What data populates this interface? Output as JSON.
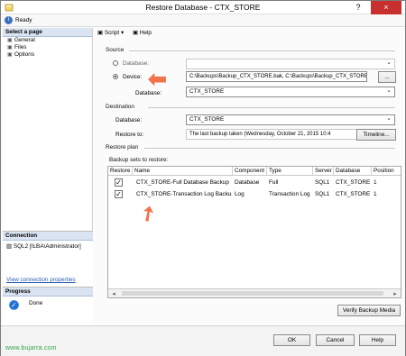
{
  "window": {
    "title": "Restore Database - CTX_STORE",
    "help_icon": "?",
    "close_icon": "×",
    "status": "Ready"
  },
  "sidebar": {
    "select_page": "Select a page",
    "pages": [
      {
        "label": "General",
        "icon": "page-icon"
      },
      {
        "label": "Files",
        "icon": "page-icon"
      },
      {
        "label": "Options",
        "icon": "page-icon"
      }
    ],
    "connection_title": "Connection",
    "connection_text": "SQL2 [ILBA\\Administrator]",
    "view_connection_properties": "View connection properties",
    "progress_title": "Progress",
    "progress_status": "Done"
  },
  "toolbar": {
    "script_label": "Script",
    "help_label": "Help",
    "script_icon": "script-icon",
    "help_icon": "help-icon"
  },
  "source": {
    "section_title": "Source",
    "database_option": "Database:",
    "device_option": "Device:",
    "device_value": "C:\\Backups\\Backup_CTX_STORE.bak, C:\\Backups\\Backup_CTX_STORE",
    "browse_label": "...",
    "database_label": "Database:",
    "database_value": "CTX_STORE"
  },
  "destination": {
    "section_title": "Destination",
    "database_label": "Database:",
    "database_value": "CTX_STORE",
    "restore_to_label": "Restore to:",
    "restore_to_value": "The last backup taken (Wednesday, October 21, 2015 10:4",
    "timeline_label": "Timeline..."
  },
  "restore_plan": {
    "section_title": "Restore plan",
    "backup_sets_label": "Backup sets to restore:",
    "columns": [
      "Restore",
      "Name",
      "Component",
      "Type",
      "Server",
      "Database",
      "Position"
    ],
    "rows": [
      {
        "restore": "✓",
        "name": "CTX_STORE-Full Database Backup",
        "component": "Database",
        "type": "Full",
        "server": "SQL1",
        "database": "CTX_STORE",
        "position": "1"
      },
      {
        "restore": "✓",
        "name": "CTX_STORE-Transaction Log  Backup",
        "component": "Log",
        "type": "Transaction Log",
        "server": "SQL1",
        "database": "CTX_STORE",
        "position": "1"
      }
    ],
    "verify_label": "Verify Backup Media"
  },
  "footer": {
    "ok_label": "OK",
    "cancel_label": "Cancel",
    "help_label": "Help"
  },
  "watermark": "www.bujarra.com",
  "colors": {
    "accent_orange": "#ef744b",
    "close_red": "#c7302f",
    "header_blue": "#d9e3f1",
    "watermark_green": "#35a646"
  }
}
